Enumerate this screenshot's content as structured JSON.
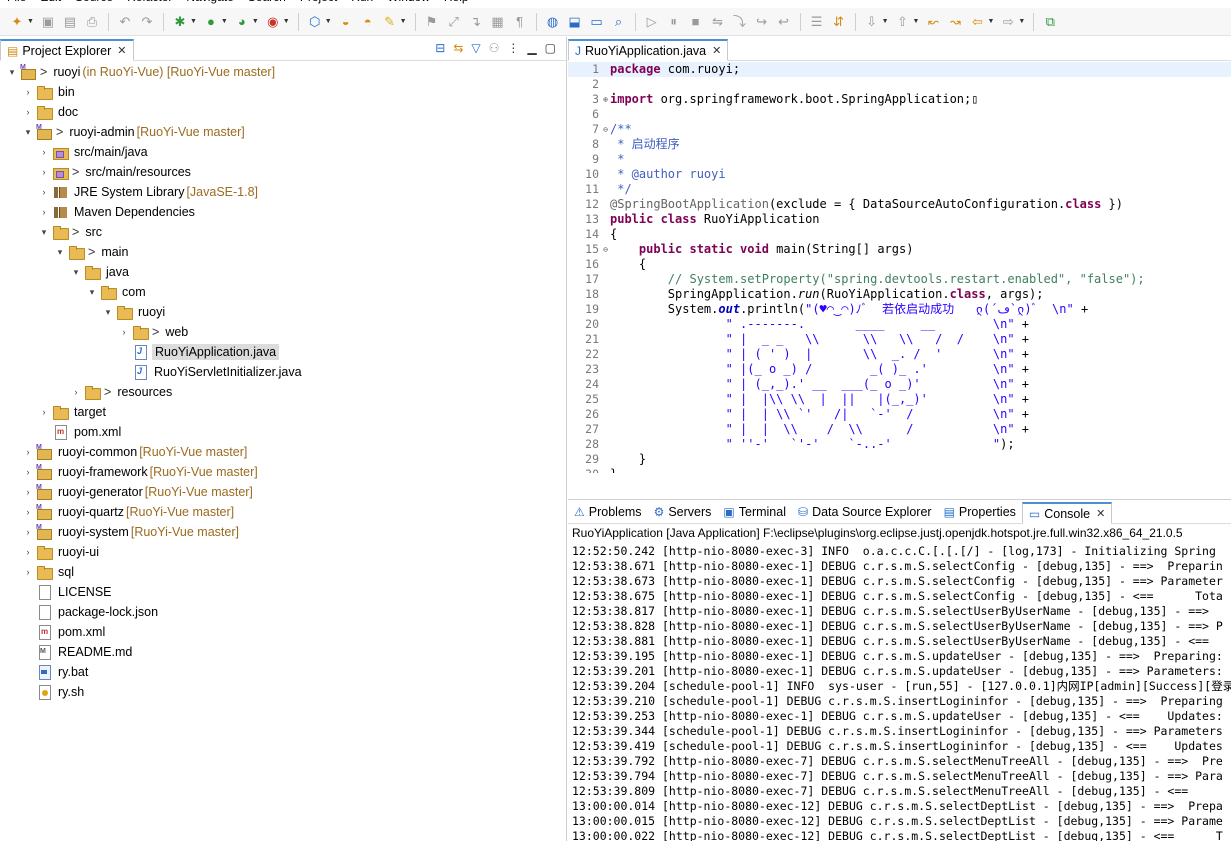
{
  "menu": [
    "File",
    "Edit",
    "Source",
    "Refactor",
    "Navigate",
    "Search",
    "Project",
    "Run",
    "Window",
    "Help"
  ],
  "explorer": {
    "tab_label": "Project Explorer",
    "tree": [
      {
        "depth": 0,
        "tw": "▾",
        "icon": "project",
        "prefix": "> ",
        "label": "ruoyi",
        "decoration": " (in RuoYi-Vue) [RuoYi-Vue master]"
      },
      {
        "depth": 1,
        "tw": "›",
        "icon": "folder",
        "label": "bin"
      },
      {
        "depth": 1,
        "tw": "›",
        "icon": "folder",
        "label": "doc"
      },
      {
        "depth": 1,
        "tw": "▾",
        "icon": "project",
        "prefix": "> ",
        "label": "ruoyi-admin",
        "decoration": " [RuoYi-Vue master]"
      },
      {
        "depth": 2,
        "tw": "›",
        "icon": "pkgsrc",
        "label": "src/main/java"
      },
      {
        "depth": 2,
        "tw": "›",
        "icon": "pkgsrc",
        "prefix": "> ",
        "label": "src/main/resources"
      },
      {
        "depth": 2,
        "tw": "›",
        "icon": "lib",
        "label": "JRE System Library",
        "decoration": " [JavaSE-1.8]"
      },
      {
        "depth": 2,
        "tw": "›",
        "icon": "lib",
        "label": "Maven Dependencies"
      },
      {
        "depth": 2,
        "tw": "▾",
        "icon": "folder",
        "prefix": "> ",
        "label": "src"
      },
      {
        "depth": 3,
        "tw": "▾",
        "icon": "folder",
        "prefix": "> ",
        "label": "main"
      },
      {
        "depth": 4,
        "tw": "▾",
        "icon": "folder",
        "label": "java"
      },
      {
        "depth": 5,
        "tw": "▾",
        "icon": "folder",
        "label": "com"
      },
      {
        "depth": 6,
        "tw": "▾",
        "icon": "folder",
        "label": "ruoyi"
      },
      {
        "depth": 7,
        "tw": "›",
        "icon": "folder",
        "prefix": "> ",
        "label": "web"
      },
      {
        "depth": 7,
        "tw": "",
        "icon": "java",
        "label": "RuoYiApplication.java",
        "selected": true
      },
      {
        "depth": 7,
        "tw": "",
        "icon": "java",
        "label": "RuoYiServletInitializer.java"
      },
      {
        "depth": 4,
        "tw": "›",
        "icon": "folder",
        "prefix": "> ",
        "label": "resources"
      },
      {
        "depth": 2,
        "tw": "›",
        "icon": "folder",
        "label": "target"
      },
      {
        "depth": 2,
        "tw": "",
        "icon": "xml",
        "label": "pom.xml"
      },
      {
        "depth": 1,
        "tw": "›",
        "icon": "project",
        "label": "ruoyi-common",
        "decoration": " [RuoYi-Vue master]"
      },
      {
        "depth": 1,
        "tw": "›",
        "icon": "project",
        "label": "ruoyi-framework",
        "decoration": " [RuoYi-Vue master]"
      },
      {
        "depth": 1,
        "tw": "›",
        "icon": "project",
        "label": "ruoyi-generator",
        "decoration": " [RuoYi-Vue master]"
      },
      {
        "depth": 1,
        "tw": "›",
        "icon": "project",
        "label": "ruoyi-quartz",
        "decoration": " [RuoYi-Vue master]"
      },
      {
        "depth": 1,
        "tw": "›",
        "icon": "project",
        "label": "ruoyi-system",
        "decoration": " [RuoYi-Vue master]"
      },
      {
        "depth": 1,
        "tw": "›",
        "icon": "folder",
        "label": "ruoyi-ui"
      },
      {
        "depth": 1,
        "tw": "›",
        "icon": "folder",
        "label": "sql"
      },
      {
        "depth": 1,
        "tw": "",
        "icon": "file",
        "label": "LICENSE"
      },
      {
        "depth": 1,
        "tw": "",
        "icon": "file",
        "label": "package-lock.json"
      },
      {
        "depth": 1,
        "tw": "",
        "icon": "xml",
        "label": "pom.xml"
      },
      {
        "depth": 1,
        "tw": "",
        "icon": "md",
        "label": "README.md"
      },
      {
        "depth": 1,
        "tw": "",
        "icon": "bat",
        "label": "ry.bat"
      },
      {
        "depth": 1,
        "tw": "",
        "icon": "sh",
        "label": "ry.sh"
      }
    ]
  },
  "editor": {
    "tab_label": "RuoYiApplication.java",
    "lines": [
      {
        "n": "1",
        "fold": "",
        "hl": true,
        "segs": [
          [
            "kw",
            "package"
          ],
          [
            "",
            " com.ruoyi;"
          ]
        ]
      },
      {
        "n": "2",
        "fold": "",
        "segs": [
          [
            "",
            ""
          ]
        ]
      },
      {
        "n": "3",
        "fold": "⊕",
        "segs": [
          [
            "kw",
            "import"
          ],
          [
            "",
            " org.springframework.boot.SpringApplication;▯"
          ]
        ]
      },
      {
        "n": "6",
        "fold": "",
        "segs": [
          [
            "",
            ""
          ]
        ]
      },
      {
        "n": "7",
        "fold": "⊖",
        "segs": [
          [
            "jd",
            "/**"
          ]
        ]
      },
      {
        "n": "8",
        "fold": "",
        "segs": [
          [
            "jd",
            " * 启动程序"
          ]
        ]
      },
      {
        "n": "9",
        "fold": "",
        "segs": [
          [
            "jd",
            " *"
          ]
        ]
      },
      {
        "n": "10",
        "fold": "",
        "segs": [
          [
            "jd",
            " * @author ruoyi"
          ]
        ]
      },
      {
        "n": "11",
        "fold": "",
        "segs": [
          [
            "jd",
            " */"
          ]
        ]
      },
      {
        "n": "12",
        "fold": "",
        "segs": [
          [
            "ann",
            "@SpringBootApplication"
          ],
          [
            "",
            "(exclude = { DataSourceAutoConfiguration."
          ],
          [
            "kw",
            "class"
          ],
          [
            "",
            " })"
          ]
        ]
      },
      {
        "n": "13",
        "fold": "",
        "segs": [
          [
            "kw",
            "public class"
          ],
          [
            "",
            " RuoYiApplication"
          ]
        ]
      },
      {
        "n": "14",
        "fold": "",
        "segs": [
          [
            "",
            "{"
          ]
        ]
      },
      {
        "n": "15",
        "fold": "⊖",
        "segs": [
          [
            "",
            "    "
          ],
          [
            "kw",
            "public static void"
          ],
          [
            "",
            " main(String[] args)"
          ]
        ]
      },
      {
        "n": "16",
        "fold": "",
        "segs": [
          [
            "",
            "    {"
          ]
        ]
      },
      {
        "n": "17",
        "fold": "",
        "segs": [
          [
            "cm",
            "        // System.setProperty(\"spring.devtools.restart.enabled\", \"false\");"
          ]
        ]
      },
      {
        "n": "18",
        "fold": "",
        "segs": [
          [
            "",
            "        SpringApplication."
          ],
          [
            "ital",
            "run"
          ],
          [
            "",
            "(RuoYiApplication."
          ],
          [
            "kw",
            "class"
          ],
          [
            "",
            ", args);"
          ]
        ]
      },
      {
        "n": "19",
        "fold": "",
        "segs": [
          [
            "",
            "        System."
          ],
          [
            "fld",
            "out"
          ],
          [
            "",
            ".println("
          ],
          [
            "str",
            "\"(♥◠‿◠)ﾉﾞ  若依启动成功   ლ(´ڡ`ლ)ﾞ  \\n\""
          ],
          [
            "",
            " +"
          ]
        ]
      },
      {
        "n": "20",
        "fold": "",
        "segs": [
          [
            "str",
            "                \" .-------.       ____     __        \\n\""
          ],
          [
            "",
            " +"
          ]
        ]
      },
      {
        "n": "21",
        "fold": "",
        "segs": [
          [
            "str",
            "                \" |  _ _   \\\\      \\\\   \\\\   /  /    \\n\""
          ],
          [
            "",
            " +"
          ]
        ]
      },
      {
        "n": "22",
        "fold": "",
        "segs": [
          [
            "str",
            "                \" | ( ' )  |       \\\\  _. /  '       \\n\""
          ],
          [
            "",
            " +"
          ]
        ]
      },
      {
        "n": "23",
        "fold": "",
        "segs": [
          [
            "str",
            "                \" |(_ o _) /        _( )_ .'         \\n\""
          ],
          [
            "",
            " +"
          ]
        ]
      },
      {
        "n": "24",
        "fold": "",
        "segs": [
          [
            "str",
            "                \" | (_,_).' __  ___(_ o _)'          \\n\""
          ],
          [
            "",
            " +"
          ]
        ]
      },
      {
        "n": "25",
        "fold": "",
        "segs": [
          [
            "str",
            "                \" |  |\\\\ \\\\  |  ||   |(_,_)'         \\n\""
          ],
          [
            "",
            " +"
          ]
        ]
      },
      {
        "n": "26",
        "fold": "",
        "segs": [
          [
            "str",
            "                \" |  | \\\\ `'   /|   `-'  /           \\n\""
          ],
          [
            "",
            " +"
          ]
        ]
      },
      {
        "n": "27",
        "fold": "",
        "segs": [
          [
            "str",
            "                \" |  |  \\\\    /  \\\\      /           \\n\""
          ],
          [
            "",
            " +"
          ]
        ]
      },
      {
        "n": "28",
        "fold": "",
        "segs": [
          [
            "str",
            "                \" ''-'   `'-'    `-..-'              \""
          ],
          [
            "",
            ");"
          ]
        ]
      },
      {
        "n": "29",
        "fold": "",
        "segs": [
          [
            "",
            "    }"
          ]
        ]
      },
      {
        "n": "30",
        "fold": "",
        "segs": [
          [
            "",
            "}"
          ]
        ]
      }
    ]
  },
  "bottom": {
    "tabs": [
      {
        "icon": "⚠",
        "label": "Problems",
        "active": false
      },
      {
        "icon": "⚙",
        "label": "Servers",
        "active": false
      },
      {
        "icon": "▣",
        "label": "Terminal",
        "active": false
      },
      {
        "icon": "⛁",
        "label": "Data Source Explorer",
        "active": false
      },
      {
        "icon": "▤",
        "label": "Properties",
        "active": false
      },
      {
        "icon": "▭",
        "label": "Console",
        "active": true
      }
    ],
    "console_title": "RuoYiApplication [Java Application] F:\\eclipse\\plugins\\org.eclipse.justj.openjdk.hotspot.jre.full.win32.x86_64_21.0.5",
    "logs": [
      "12:52:50.242 [http-nio-8080-exec-3] INFO  o.a.c.c.C.[.[.[/] - [log,173] - Initializing Spring",
      "12:53:38.671 [http-nio-8080-exec-1] DEBUG c.r.s.m.S.selectConfig - [debug,135] - ==>  Preparin",
      "12:53:38.673 [http-nio-8080-exec-1] DEBUG c.r.s.m.S.selectConfig - [debug,135] - ==> Parameter",
      "12:53:38.675 [http-nio-8080-exec-1] DEBUG c.r.s.m.S.selectConfig - [debug,135] - <==      Tota",
      "12:53:38.817 [http-nio-8080-exec-1] DEBUG c.r.s.m.S.selectUserByUserName - [debug,135] - ==>  ",
      "12:53:38.828 [http-nio-8080-exec-1] DEBUG c.r.s.m.S.selectUserByUserName - [debug,135] - ==> P",
      "12:53:38.881 [http-nio-8080-exec-1] DEBUG c.r.s.m.S.selectUserByUserName - [debug,135] - <==  ",
      "12:53:39.195 [http-nio-8080-exec-1] DEBUG c.r.s.m.S.updateUser - [debug,135] - ==>  Preparing:",
      "12:53:39.201 [http-nio-8080-exec-1] DEBUG c.r.s.m.S.updateUser - [debug,135] - ==> Parameters:",
      "12:53:39.204 [schedule-pool-1] INFO  sys-user - [run,55] - [127.0.0.1]内网IP[admin][Success][登录",
      "12:53:39.210 [schedule-pool-1] DEBUG c.r.s.m.S.insertLogininfor - [debug,135] - ==>  Preparing",
      "12:53:39.253 [http-nio-8080-exec-1] DEBUG c.r.s.m.S.updateUser - [debug,135] - <==    Updates:",
      "12:53:39.344 [schedule-pool-1] DEBUG c.r.s.m.S.insertLogininfor - [debug,135] - ==> Parameters",
      "12:53:39.419 [schedule-pool-1] DEBUG c.r.s.m.S.insertLogininfor - [debug,135] - <==    Updates",
      "12:53:39.792 [http-nio-8080-exec-7] DEBUG c.r.s.m.S.selectMenuTreeAll - [debug,135] - ==>  Pre",
      "12:53:39.794 [http-nio-8080-exec-7] DEBUG c.r.s.m.S.selectMenuTreeAll - [debug,135] - ==> Para",
      "12:53:39.809 [http-nio-8080-exec-7] DEBUG c.r.s.m.S.selectMenuTreeAll - [debug,135] - <==     ",
      "13:00:00.014 [http-nio-8080-exec-12] DEBUG c.r.s.m.S.selectDeptList - [debug,135] - ==>  Prepa",
      "13:00:00.015 [http-nio-8080-exec-12] DEBUG c.r.s.m.S.selectDeptList - [debug,135] - ==> Parame",
      "13:00:00.022 [http-nio-8080-exec-12] DEBUG c.r.s.m.S.selectDeptList - [debug,135] - <==      T"
    ]
  }
}
